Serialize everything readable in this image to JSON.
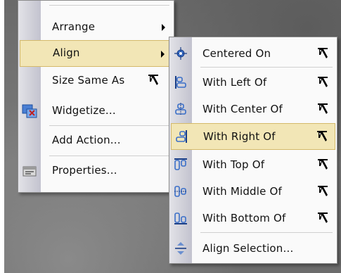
{
  "main_menu": {
    "items": [
      {
        "label": "Arrange",
        "has_submenu": true
      },
      {
        "label": "Align",
        "has_submenu": true,
        "selected": true
      },
      {
        "label": "Size Same As",
        "has_target_cursor": true
      },
      {
        "label": "Widgetize...",
        "icon": "widgetize-icon"
      },
      {
        "label": "Add Action..."
      },
      {
        "label": "Properties...",
        "icon": "properties-icon"
      }
    ]
  },
  "align_submenu": {
    "items": [
      {
        "label": "Centered On",
        "icon": "centered-on-icon"
      },
      {
        "label": "With Left Of",
        "icon": "align-left-icon"
      },
      {
        "label": "With Center Of",
        "icon": "align-center-icon"
      },
      {
        "label": "With Right Of",
        "icon": "align-right-icon",
        "selected": true
      },
      {
        "label": "With Top Of",
        "icon": "align-top-icon"
      },
      {
        "label": "With Middle Of",
        "icon": "align-middle-icon"
      },
      {
        "label": "With Bottom Of",
        "icon": "align-bottom-icon"
      },
      {
        "label": "Align Selection...",
        "icon": "align-selection-icon"
      }
    ]
  },
  "colors": {
    "highlight_fill": "#f2e6b6",
    "highlight_border": "#d4b96a",
    "menu_background": "#fafafa",
    "icon_blue": "#3a6fc8"
  }
}
